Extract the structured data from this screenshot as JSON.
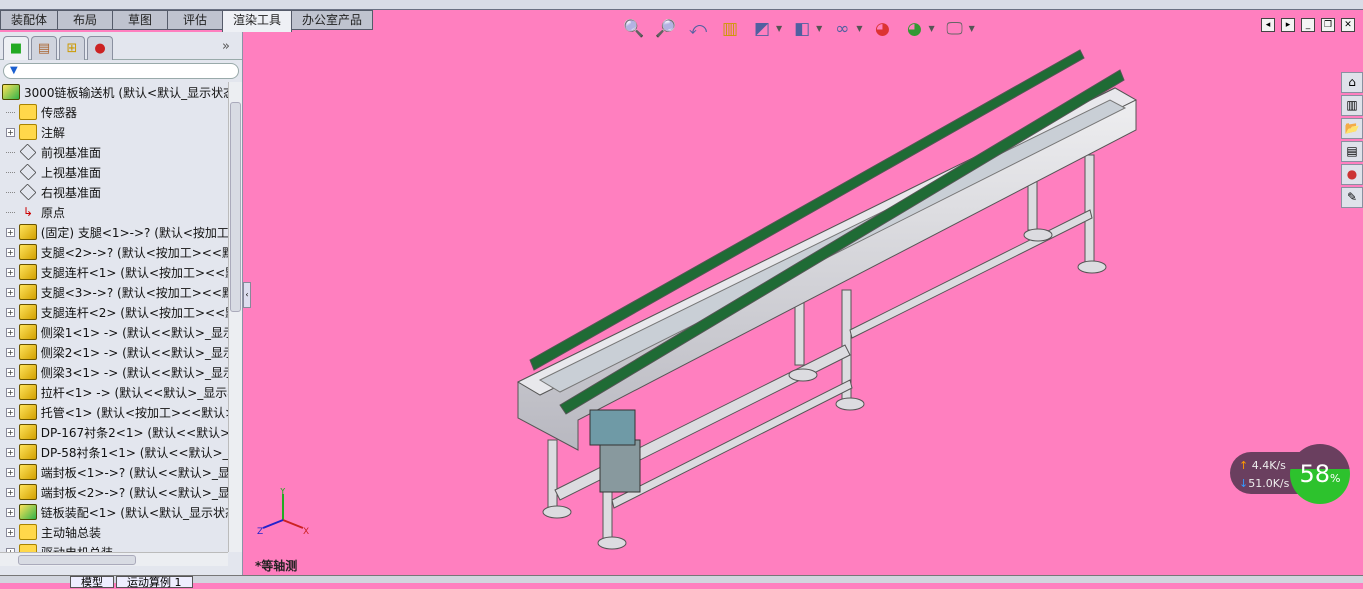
{
  "tabs": [
    "装配体",
    "布局",
    "草图",
    "评估",
    "渲染工具",
    "办公室产品"
  ],
  "active_tab": "渲染工具",
  "panel": {
    "more": "»",
    "filter_icon": "▼",
    "tree": [
      {
        "label": "3000链板输送机  (默认<默认_显示状态",
        "icon": "asm",
        "exp": false,
        "indent": 0
      },
      {
        "label": "传感器",
        "icon": "folder",
        "exp": false
      },
      {
        "label": "注解",
        "icon": "folder",
        "exp": true
      },
      {
        "label": "前视基准面",
        "icon": "plane",
        "exp": false
      },
      {
        "label": "上视基准面",
        "icon": "plane",
        "exp": false
      },
      {
        "label": "右视基准面",
        "icon": "plane",
        "exp": false
      },
      {
        "label": "原点",
        "icon": "origin",
        "exp": false
      },
      {
        "label": "(固定) 支腿<1>->? (默认<按加工>",
        "icon": "part",
        "exp": true
      },
      {
        "label": "支腿<2>->? (默认<按加工><<默",
        "icon": "part",
        "exp": true
      },
      {
        "label": "支腿连杆<1> (默认<按加工><<默",
        "icon": "part",
        "exp": true
      },
      {
        "label": "支腿<3>->? (默认<按加工><<默",
        "icon": "part",
        "exp": true
      },
      {
        "label": "支腿连杆<2> (默认<按加工><<默",
        "icon": "part",
        "exp": true
      },
      {
        "label": "侧梁1<1> -> (默认<<默认>_显示",
        "icon": "part",
        "exp": true
      },
      {
        "label": "侧梁2<1> -> (默认<<默认>_显示",
        "icon": "part",
        "exp": true
      },
      {
        "label": "侧梁3<1> -> (默认<<默认>_显示",
        "icon": "part",
        "exp": true
      },
      {
        "label": "拉杆<1> -> (默认<<默认>_显示状",
        "icon": "part",
        "exp": true
      },
      {
        "label": "托管<1> (默认<按加工><<默认>",
        "icon": "part",
        "exp": true
      },
      {
        "label": "DP-167衬条2<1> (默认<<默认>_",
        "icon": "part",
        "exp": true
      },
      {
        "label": "DP-58衬条1<1> (默认<<默认>_显",
        "icon": "part",
        "exp": true
      },
      {
        "label": "端封板<1>->? (默认<<默认>_显示",
        "icon": "part",
        "exp": true
      },
      {
        "label": "端封板<2>->? (默认<<默认>_显示",
        "icon": "part",
        "exp": true
      },
      {
        "label": "链板装配<1> (默认<默认_显示状态",
        "icon": "asm",
        "exp": true
      },
      {
        "label": "主动轴总装",
        "icon": "folder",
        "exp": true
      },
      {
        "label": "驱动电机总装",
        "icon": "folder",
        "exp": true
      }
    ]
  },
  "bottom_tabs": [
    "模型",
    "运动算例 1"
  ],
  "view_name": "*等轴测",
  "network": {
    "up": "4.4",
    "down": "51.0",
    "unit": "K/s",
    "percent": "58",
    "pct_sign": "%",
    "up_arrow": "↑",
    "down_arrow": "↓"
  },
  "colors": {
    "background": "#ff7fbf",
    "rail": "#1f6b35",
    "frame": "#d8d8dc"
  }
}
